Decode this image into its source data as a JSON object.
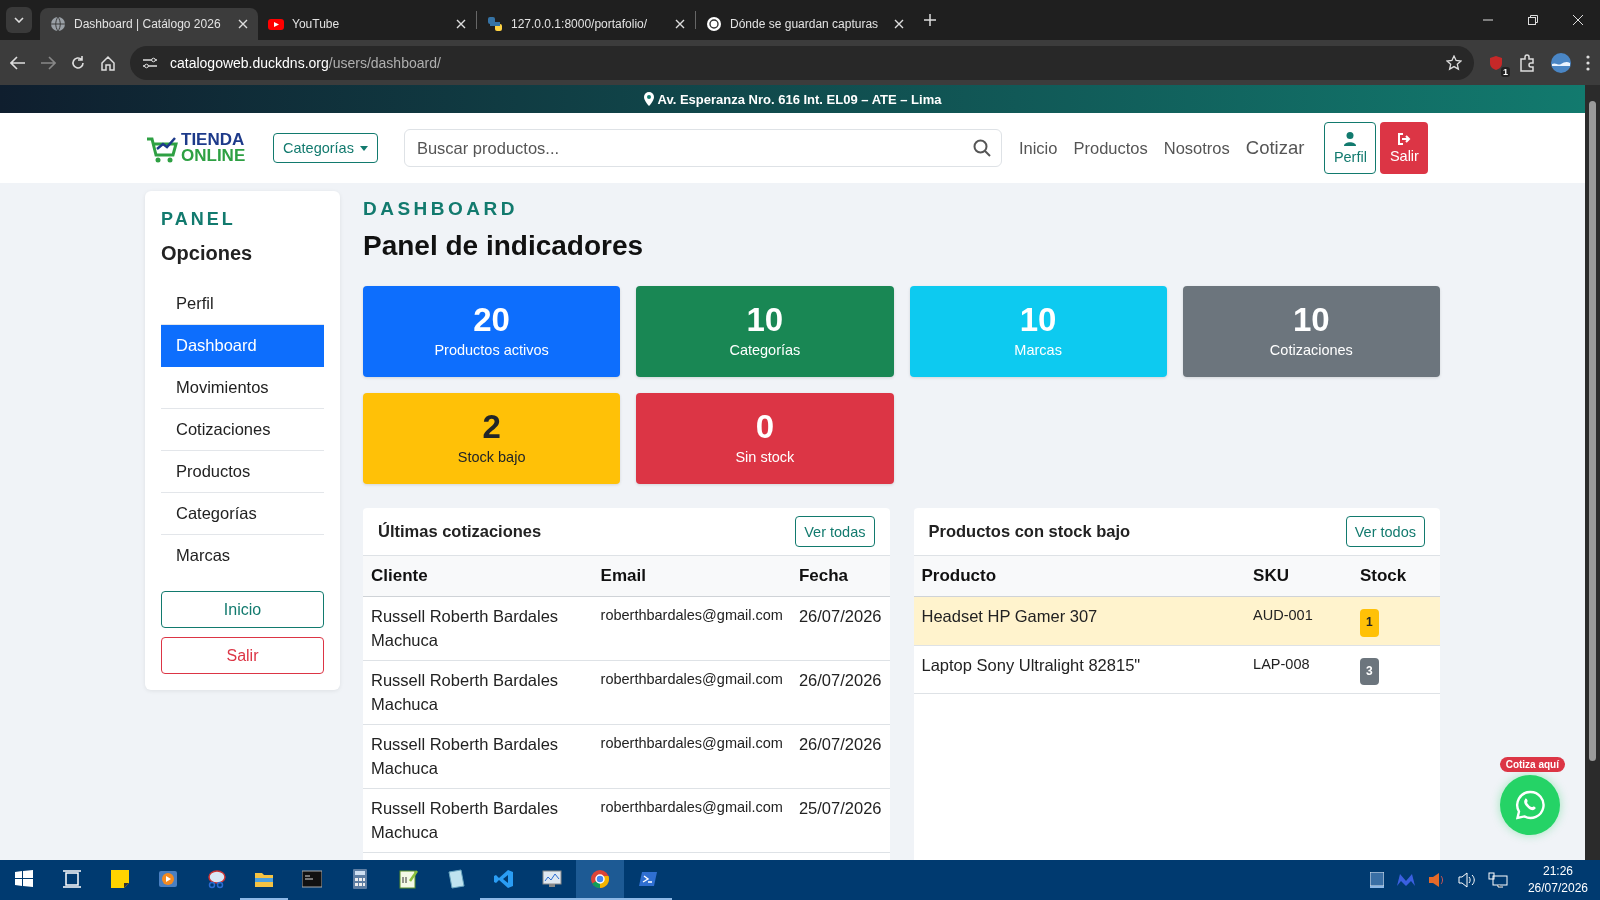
{
  "browser": {
    "tabs": [
      {
        "title": "Dashboard | Catálogo 2026",
        "kind": "globe",
        "selected": true
      },
      {
        "title": "YouTube",
        "kind": "youtube",
        "selected": false
      },
      {
        "title": "127.0.0.1:8000/portafolio/",
        "kind": "python",
        "selected": false
      },
      {
        "title": "Dónde se guardan capturas",
        "kind": "chat",
        "selected": false
      }
    ],
    "url": {
      "host": "catalogoweb.duckdns.org",
      "path": "/users/dashboard/"
    },
    "extension_badge": "1"
  },
  "page": {
    "address": "Av. Esperanza Nro. 616 Int. EL09 – ATE – Lima",
    "logo": {
      "line1": "TIENDA",
      "line2": "ONLINE"
    },
    "navbar": {
      "categories": "Categorías",
      "search": {
        "placeholder": "Buscar productos..."
      },
      "links": [
        {
          "label": "Inicio",
          "kind": "link"
        },
        {
          "label": "Productos",
          "kind": "link"
        },
        {
          "label": "Nosotros",
          "kind": "link"
        },
        {
          "label": "Cotizar",
          "kind": "large"
        }
      ],
      "buttons": [
        {
          "label": "Perfil",
          "kind": "profile"
        },
        {
          "label": "Salir",
          "kind": "logout"
        }
      ]
    },
    "sidebar": {
      "eyebrow": "PANEL",
      "title": "Opciones",
      "items": [
        {
          "label": "Perfil",
          "selected": false
        },
        {
          "label": "Dashboard",
          "selected": true
        },
        {
          "label": "Movimientos",
          "selected": false
        },
        {
          "label": "Cotizaciones",
          "selected": false
        },
        {
          "label": "Productos",
          "selected": false
        },
        {
          "label": "Categorías",
          "selected": false
        },
        {
          "label": "Marcas",
          "selected": false
        }
      ],
      "buttons": [
        {
          "label": "Inicio",
          "kind": "primary"
        },
        {
          "label": "Salir",
          "kind": "danger"
        }
      ]
    },
    "header": {
      "eyebrow": "DASHBOARD",
      "title": "Panel de indicadores"
    },
    "stats": [
      {
        "value": "20",
        "label": "Productos activos",
        "color": "#0d6efd",
        "dark_text": false
      },
      {
        "value": "10",
        "label": "Categorías",
        "color": "#198754",
        "dark_text": false
      },
      {
        "value": "10",
        "label": "Marcas",
        "color": "#0dcaf0",
        "dark_text": false
      },
      {
        "value": "10",
        "label": "Cotizaciones",
        "color": "#6c757d",
        "dark_text": false
      },
      {
        "value": "2",
        "label": "Stock bajo",
        "color": "#ffc107",
        "dark_text": true
      },
      {
        "value": "0",
        "label": "Sin stock",
        "color": "#dc3545",
        "dark_text": false
      }
    ],
    "quotes": {
      "title": "Últimas cotizaciones",
      "button": "Ver todas",
      "columns": [
        "Cliente",
        "Email",
        "Fecha"
      ],
      "rows": [
        [
          "Russell Roberth Bardales Machuca",
          "roberthbardales@gmail.com",
          "26/07/2026"
        ],
        [
          "Russell Roberth Bardales Machuca",
          "roberthbardales@gmail.com",
          "26/07/2026"
        ],
        [
          "Russell Roberth Bardales Machuca",
          "roberthbardales@gmail.com",
          "26/07/2026"
        ],
        [
          "Russell Roberth Bardales Machuca",
          "roberthbardales@gmail.com",
          "25/07/2026"
        ]
      ]
    },
    "low_stock": {
      "title": "Productos con stock bajo",
      "button": "Ver todos",
      "columns": [
        "Producto",
        "SKU",
        "Stock"
      ],
      "rows": [
        {
          "product": "Headset HP Gamer 307",
          "sku": "AUD-001",
          "stock": "1",
          "color": "#ffc107",
          "highlighted": true
        },
        {
          "product": "Laptop Sony Ultralight 82815\"",
          "sku": "LAP-008",
          "stock": "3",
          "color": "#6c757d",
          "highlighted": false
        }
      ]
    },
    "whatsapp": {
      "badge": "Cotiza aquí"
    }
  },
  "taskbar": {
    "apps": [
      {
        "kind": "start",
        "running": false,
        "selected": false
      },
      {
        "kind": "taskview",
        "running": false,
        "selected": false
      },
      {
        "kind": "sticky",
        "running": false,
        "selected": false
      },
      {
        "kind": "media",
        "running": false,
        "selected": false
      },
      {
        "kind": "snip",
        "running": false,
        "selected": false
      },
      {
        "kind": "explorer",
        "running": true,
        "selected": false
      },
      {
        "kind": "terminal",
        "running": false,
        "selected": false
      },
      {
        "kind": "calculator",
        "running": false,
        "selected": false
      },
      {
        "kind": "notepadpp",
        "running": false,
        "selected": false
      },
      {
        "kind": "notepad",
        "running": false,
        "selected": false
      },
      {
        "kind": "vscode",
        "running": true,
        "selected": false
      },
      {
        "kind": "perfmon",
        "running": true,
        "selected": false
      },
      {
        "kind": "chrome",
        "running": true,
        "selected": true
      },
      {
        "kind": "powershell",
        "running": true,
        "selected": false
      }
    ],
    "clock": {
      "time": "21:26",
      "date": "26/07/2026"
    }
  }
}
